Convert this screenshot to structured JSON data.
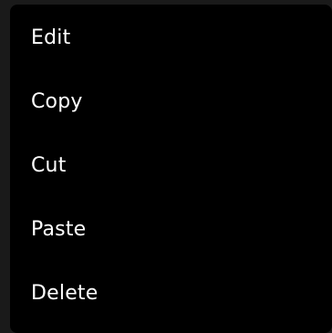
{
  "menu": {
    "items": [
      {
        "label": "Edit"
      },
      {
        "label": "Copy"
      },
      {
        "label": "Cut"
      },
      {
        "label": "Paste"
      },
      {
        "label": "Delete"
      }
    ]
  },
  "colors": {
    "background": "#1a1a1a",
    "menu_background": "#000000",
    "text": "#ffffff"
  }
}
